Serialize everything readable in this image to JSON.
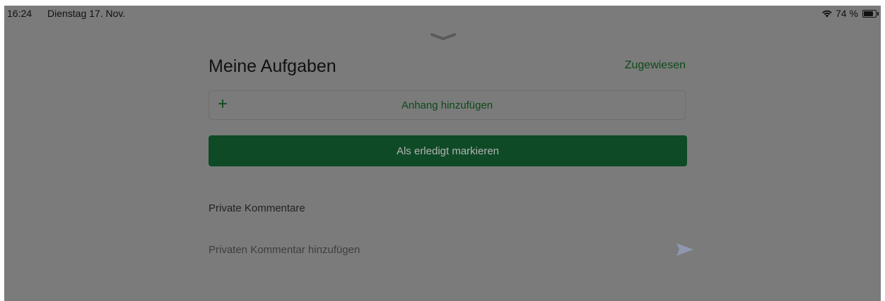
{
  "status_bar": {
    "time": "16:24",
    "date": "Dienstag 17. Nov.",
    "battery_text": "74 %",
    "battery_level": 0.74,
    "wifi_icon": "wifi-icon",
    "battery_icon": "battery-icon"
  },
  "sheet": {
    "handle_icon": "chevron-down-icon",
    "title": "Meine Aufgaben",
    "assigned_link": "Zugewiesen",
    "attach": {
      "icon": "plus-icon",
      "label": "Anhang hinzufügen"
    },
    "mark_done_label": "Als erledigt markieren",
    "private_comments": {
      "heading": "Private Kommentare",
      "placeholder": "Privaten Kommentar hinzufügen",
      "send_icon": "send-icon"
    }
  },
  "colors": {
    "overlay": "#7b7b7b",
    "accent_green": "#0f4a26",
    "link_green": "#0c4a1a",
    "send_icon_color": "#8f96b0"
  }
}
